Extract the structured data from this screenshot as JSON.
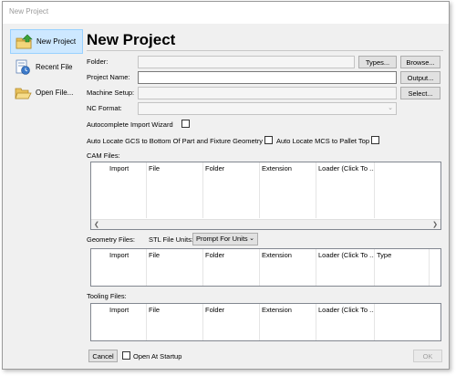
{
  "window": {
    "title": "New Project"
  },
  "sidebar": {
    "items": [
      {
        "label": "New Project",
        "icon": "new-project-icon",
        "active": true
      },
      {
        "label": "Recent File",
        "icon": "recent-file-icon",
        "active": false
      },
      {
        "label": "Open File...",
        "icon": "open-folder-icon",
        "active": false
      }
    ]
  },
  "heading": "New Project",
  "form": {
    "folder_label": "Folder:",
    "project_name_label": "Project Name:",
    "machine_setup_label": "Machine Setup:",
    "nc_format_label": "NC Format:",
    "types_button": "Types...",
    "browse_button": "Browse...",
    "output_button": "Output...",
    "select_button": "Select...",
    "autocomplete_label": "Autocomplete Import Wizard",
    "auto_gcs_label": "Auto Locate GCS to Bottom Of Part and Fixture Geometry",
    "auto_mcs_label": "Auto Locate MCS to Pallet Top"
  },
  "cam": {
    "label": "CAM Files:",
    "columns": [
      "Import",
      "File",
      "Folder",
      "Extension",
      "Loader (Click To ..."
    ]
  },
  "geometry": {
    "label": "Geometry Files:",
    "stl_units_label": "STL File Units:",
    "stl_units_value": "Prompt For Units",
    "columns": [
      "Import",
      "File",
      "Folder",
      "Extension",
      "Loader (Click To ...",
      "Type"
    ]
  },
  "tooling": {
    "label": "Tooling Files:",
    "columns": [
      "Import",
      "File",
      "Folder",
      "Extension",
      "Loader (Click To ..."
    ]
  },
  "footer": {
    "cancel_button": "Cancel",
    "open_at_startup_label": "Open At Startup",
    "ok_button": "OK"
  },
  "colors": {
    "active_item_bg": "#cde8ff",
    "active_item_border": "#99d1ff",
    "window_bg": "#f0f0f0"
  }
}
